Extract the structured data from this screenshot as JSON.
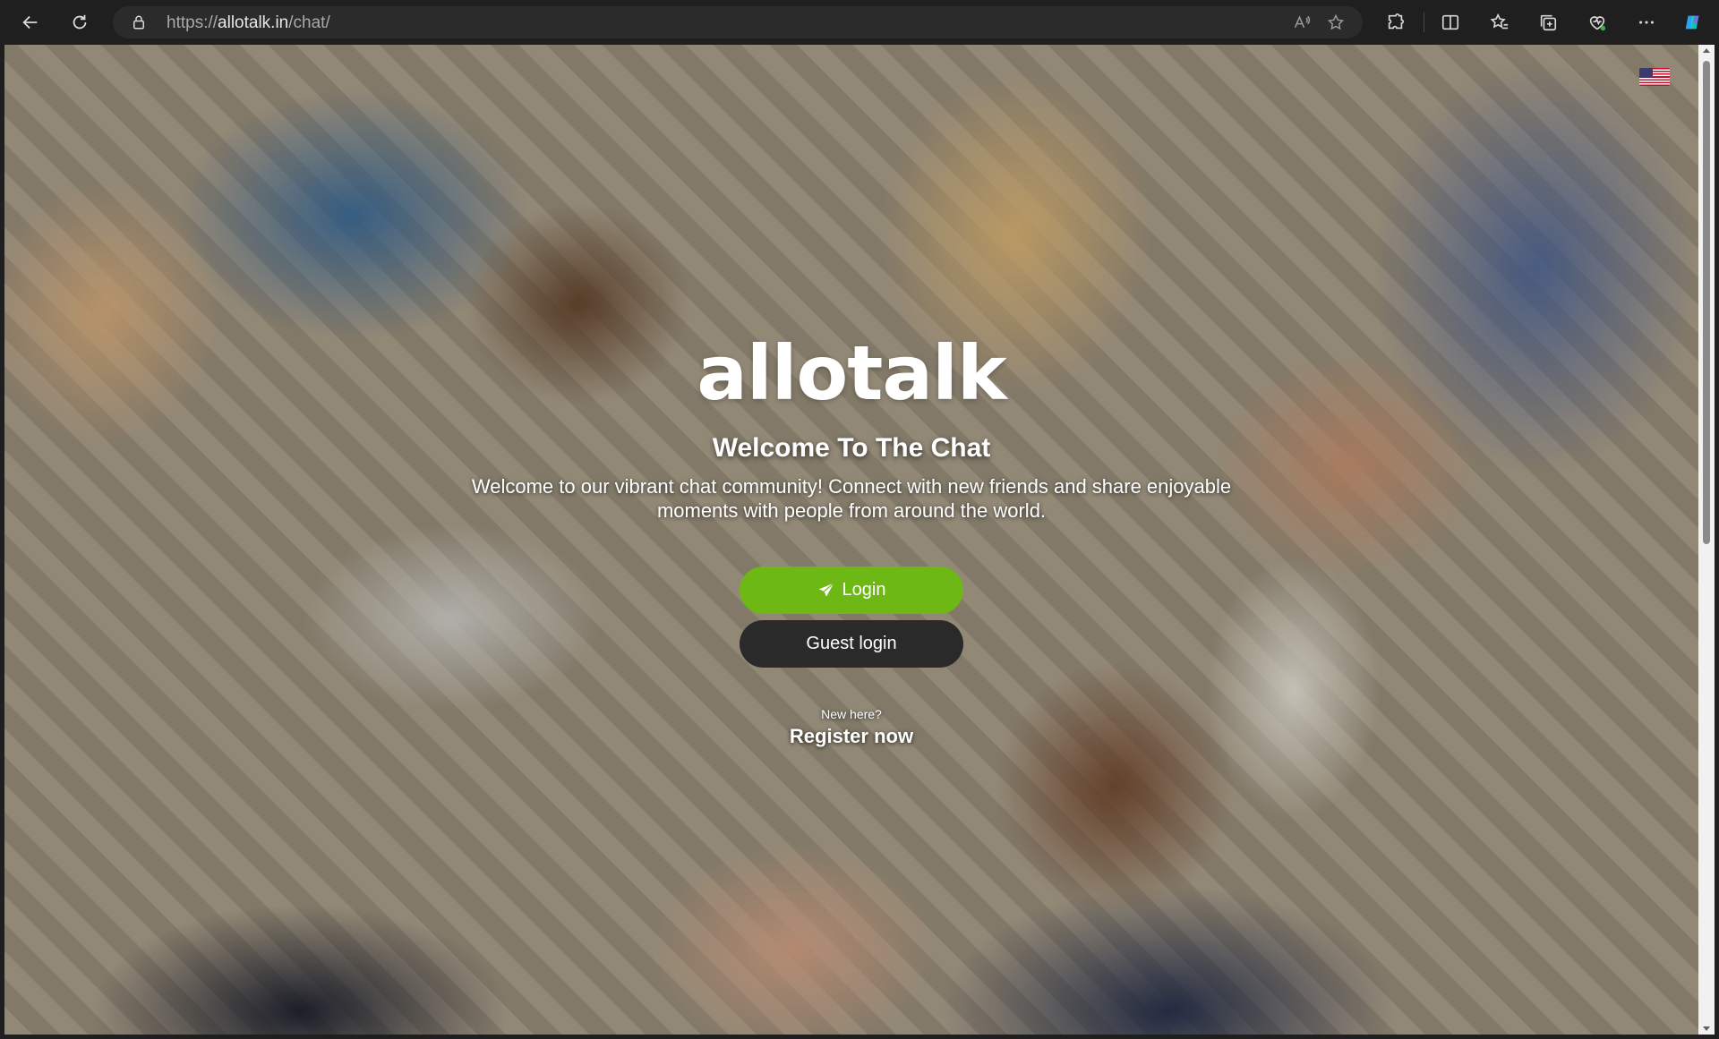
{
  "browser": {
    "url_prefix": "https://",
    "url_host": "allotalk.in",
    "url_path": "/chat/",
    "icons": [
      "back-icon",
      "refresh-icon",
      "lock-icon",
      "read-aloud-icon",
      "favorite-star-icon",
      "extensions-icon",
      "split-screen-icon",
      "favorites-icon",
      "collections-icon",
      "browser-essentials-icon",
      "more-icon",
      "copilot-icon"
    ]
  },
  "page": {
    "logo": "allotalk",
    "title": "Welcome To The Chat",
    "intro": "Welcome to our vibrant chat community! Connect with new friends and share enjoyable moments with people from around the world.",
    "login_label": "Login",
    "guest_label": "Guest login",
    "new_here": "New here?",
    "register_label": "Register now",
    "language_flag": "us-flag-icon"
  },
  "colors": {
    "login_button": "#6db814",
    "guest_button": "#2a2a2a",
    "chrome_bg": "#1f1f1f"
  }
}
